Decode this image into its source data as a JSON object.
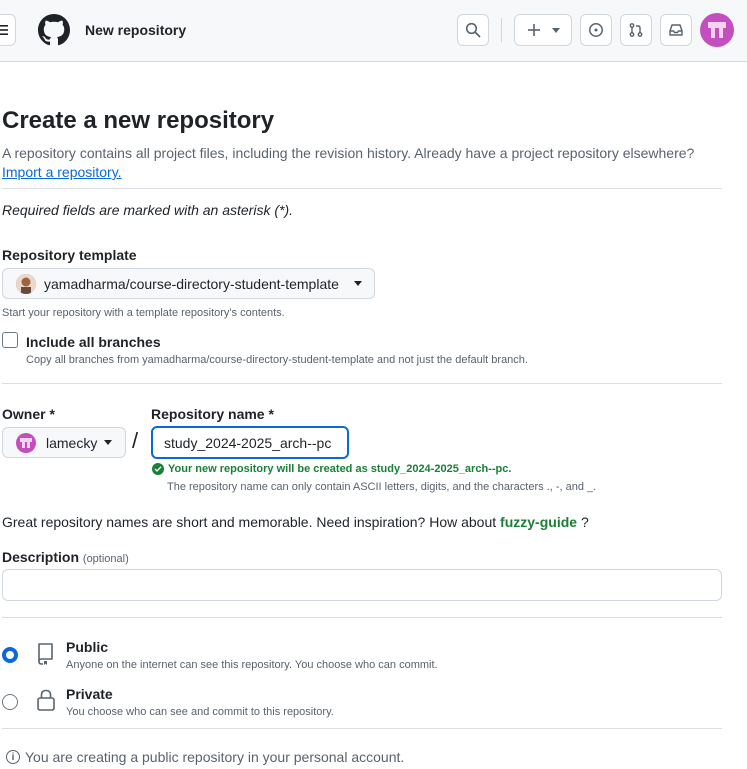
{
  "header": {
    "title": "New repository",
    "icons": [
      "hamburger-icon",
      "github-logo",
      "search-icon",
      "plus-icon",
      "issues-icon",
      "pull-requests-icon",
      "inbox-icon",
      "avatar"
    ]
  },
  "page": {
    "title": "Create a new repository",
    "subtitle": "A repository contains all project files, including the revision history. Already have a project repository elsewhere?",
    "import_link": "Import a repository.",
    "required_note": "Required fields are marked with an asterisk (*)."
  },
  "template": {
    "label": "Repository template",
    "selected": "yamadharma/course-directory-student-template",
    "note": "Start your repository with a template repository's contents."
  },
  "branches": {
    "label": "Include all branches",
    "note": "Copy all branches from yamadharma/course-directory-student-template and not just the default branch."
  },
  "owner": {
    "label": "Owner *",
    "selected": "lamecky"
  },
  "repo_name": {
    "label": "Repository name *",
    "value": "study_2024-2025_arch--pc",
    "valid_message": "Your new repository will be created as study_2024-2025_arch--pc.",
    "ascii_note": "The repository name can only contain ASCII letters, digits, and the characters ., -, and _."
  },
  "suggestion": {
    "text": "Great repository names are short and memorable. Need inspiration? How about",
    "name": "fuzzy-guide",
    "suffix": "?"
  },
  "description": {
    "label": "Description",
    "optional": "(optional)",
    "value": ""
  },
  "visibility": {
    "public": {
      "title": "Public",
      "desc": "Anyone on the internet can see this repository. You choose who can commit.",
      "checked": true
    },
    "private": {
      "title": "Private",
      "desc": "You choose who can see and commit to this repository.",
      "checked": false
    }
  },
  "info": {
    "text": "You are creating a public repository in your personal account."
  },
  "colors": {
    "accent": "#0969da",
    "success": "#1a7f37",
    "muted": "#59636e",
    "border": "#d0d7de"
  }
}
